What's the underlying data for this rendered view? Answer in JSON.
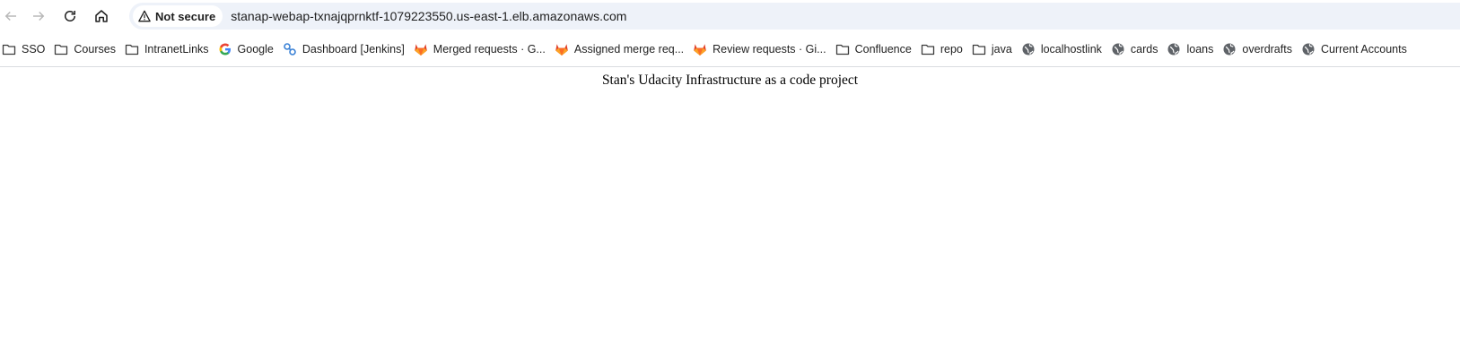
{
  "browser": {
    "security_label": "Not secure",
    "url": "stanap-webap-txnajqprnktf-1079223550.us-east-1.elb.amazonaws.com"
  },
  "bookmarks": [
    {
      "label": "SSO",
      "icon": "folder-icon"
    },
    {
      "label": "Courses",
      "icon": "folder-icon"
    },
    {
      "label": "IntranetLinks",
      "icon": "folder-icon"
    },
    {
      "label": "Google",
      "icon": "google-icon"
    },
    {
      "label": "Dashboard [Jenkins]",
      "icon": "jenkins-icon"
    },
    {
      "label": "Merged requests · G...",
      "icon": "gitlab-icon"
    },
    {
      "label": "Assigned merge req...",
      "icon": "gitlab-icon"
    },
    {
      "label": "Review requests · Gi...",
      "icon": "gitlab-icon"
    },
    {
      "label": "Confluence",
      "icon": "folder-icon"
    },
    {
      "label": "repo",
      "icon": "folder-icon"
    },
    {
      "label": "java",
      "icon": "folder-icon"
    },
    {
      "label": "localhostlink",
      "icon": "globe-icon"
    },
    {
      "label": "cards",
      "icon": "globe-icon"
    },
    {
      "label": "loans",
      "icon": "globe-icon"
    },
    {
      "label": "overdrafts",
      "icon": "globe-icon"
    },
    {
      "label": "Current Accounts",
      "icon": "globe-icon"
    }
  ],
  "page": {
    "heading": "Stan's Udacity Infrastructure as a code project"
  }
}
